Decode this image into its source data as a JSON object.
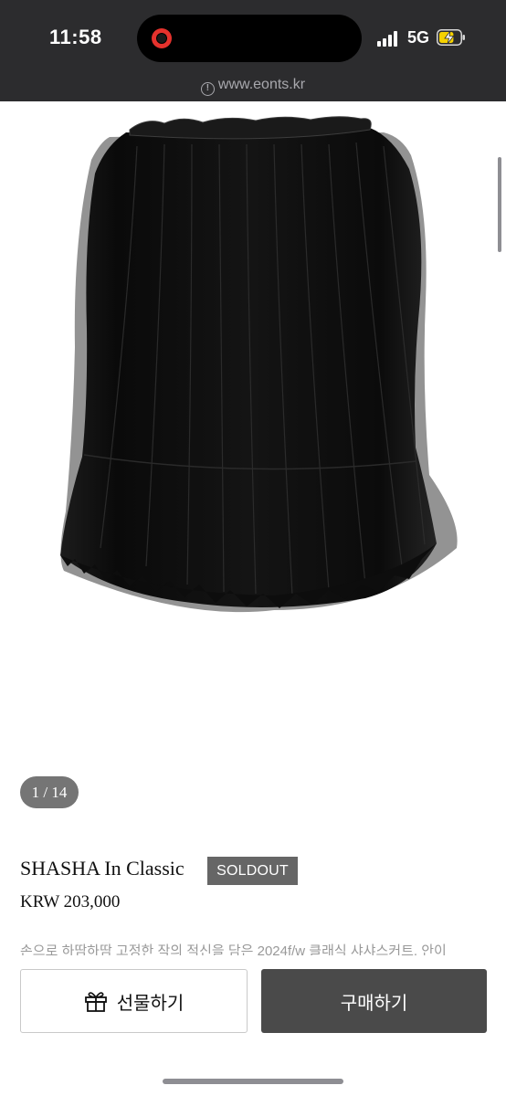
{
  "status_bar": {
    "time": "11:58",
    "network": "5G",
    "battery_level": 0.7
  },
  "browser": {
    "url": "www.eonts.kr"
  },
  "gallery": {
    "counter": "1 / 14"
  },
  "product": {
    "name": "SHASHA In Classic",
    "status_badge": "SOLDOUT",
    "price": "KRW 203,000",
    "description_preview": "손으로 하땀하땀 고정한 작의 적신을 담은 2024f/w 클래식 샤샤스커트. 안이"
  },
  "actions": {
    "gift_label": "선물하기",
    "buy_label": "구매하기"
  },
  "colors": {
    "status_bar_bg": "#2c2c2e",
    "badge_bg": "#666666",
    "buy_button_bg": "#4a4a4a",
    "recording_dot": "#e5322d",
    "battery_fill": "#f5d100"
  },
  "icons": [
    "recording-icon",
    "signal-icon",
    "battery-charging-icon",
    "info-icon",
    "gift-icon"
  ]
}
